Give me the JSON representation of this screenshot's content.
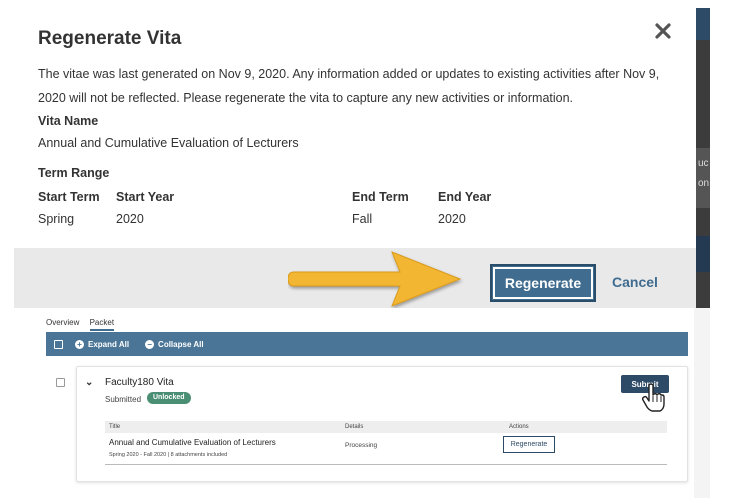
{
  "modal": {
    "title": "Regenerate Vita",
    "description": "The vitae was last generated on Nov 9, 2020. Any information added or updates to existing activities after Nov 9, 2020 will not be reflected. Please regenerate the vita to capture any new activities or information.",
    "vita_name_label": "Vita Name",
    "vita_name_value": "Annual and Cumulative Evaluation of Lecturers",
    "term_range_label": "Term Range",
    "start_term_label": "Start Term",
    "start_term_value": "Spring",
    "start_year_label": "Start Year",
    "start_year_value": "2020",
    "end_term_label": "End Term",
    "end_term_value": "Fall",
    "end_year_label": "End Year",
    "end_year_value": "2020",
    "regenerate_label": "Regenerate",
    "cancel_label": "Cancel",
    "close_icon": "close-icon"
  },
  "backdrop": {
    "sliver_1": "uc",
    "sliver_2": "on"
  },
  "packet": {
    "tabs": [
      {
        "label": "Overview",
        "active": false
      },
      {
        "label": "Packet",
        "active": true
      }
    ],
    "toolbar": {
      "expand_all": "Expand All",
      "collapse_all": "Collapse All"
    },
    "vita": {
      "title": "Faculty180 Vita",
      "status": "Submitted",
      "badge": "Unlocked",
      "submit_label": "Submit",
      "table": {
        "headers": [
          "Title",
          "Details",
          "Actions"
        ],
        "rows": [
          {
            "title": "Annual and Cumulative Evaluation of Lecturers",
            "subtitle": "Spring 2020 - Fall 2020 | 8 attachments included",
            "details": "Processing",
            "action": "Regenerate"
          }
        ]
      }
    }
  },
  "colors": {
    "primary": "#3f6c8f",
    "toolbar": "#4a7597",
    "dark_navy": "#2d4a66",
    "badge_green": "#4a8f74",
    "arrow_yellow": "#f2b632",
    "footer_gray": "#e9e9e9"
  }
}
